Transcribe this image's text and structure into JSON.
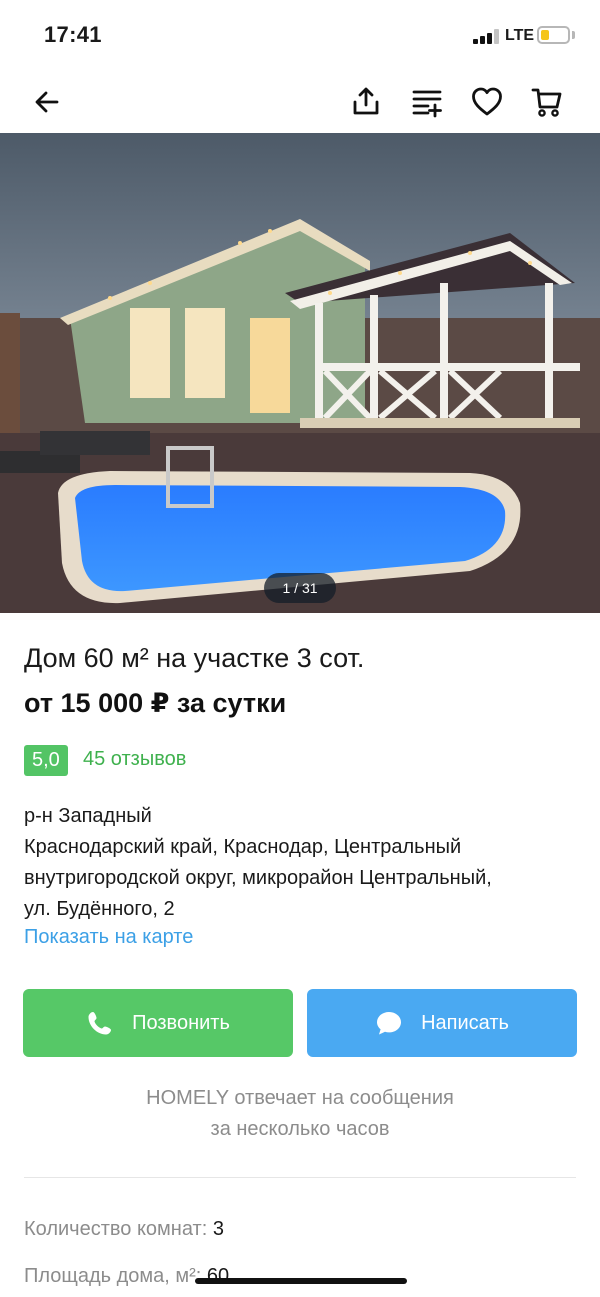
{
  "status_bar": {
    "time": "17:41",
    "network": "LTE",
    "signal_bars": 3,
    "battery_level": 0.3,
    "battery_color": "#f5c518"
  },
  "nav_bar": {
    "icons": [
      "back-arrow-icon",
      "share-icon",
      "compare-list-icon",
      "heart-icon",
      "cart-icon"
    ]
  },
  "gallery": {
    "counter": "1 / 31"
  },
  "listing": {
    "title": "Дом 60 м² на участке 3 сот.",
    "price": "от 15 000 ₽ за сутки",
    "rating": "5,0",
    "reviews": "45 отзывов",
    "district": "р-н Западный",
    "address_lines": [
      "Краснодарский край, Краснодар, Центральный",
      "внутригородской округ, микрорайон Центральный,",
      "ул. Будённого, 2"
    ],
    "map_link": "Показать на карте"
  },
  "actions": {
    "call_label": "Позвонить",
    "message_label": "Написать",
    "call_color": "#56c867",
    "message_color": "#4aa9f2"
  },
  "response_note": {
    "line1": "HOMELY отвечает на сообщения",
    "line2": "за несколько часов"
  },
  "params": [
    {
      "label": "Количество комнат: ",
      "value": "3"
    },
    {
      "label": "Площадь дома, м²: ",
      "value": "60"
    }
  ],
  "colors": {
    "accent_green": "#53c465",
    "link_blue": "#3ca0e6"
  }
}
